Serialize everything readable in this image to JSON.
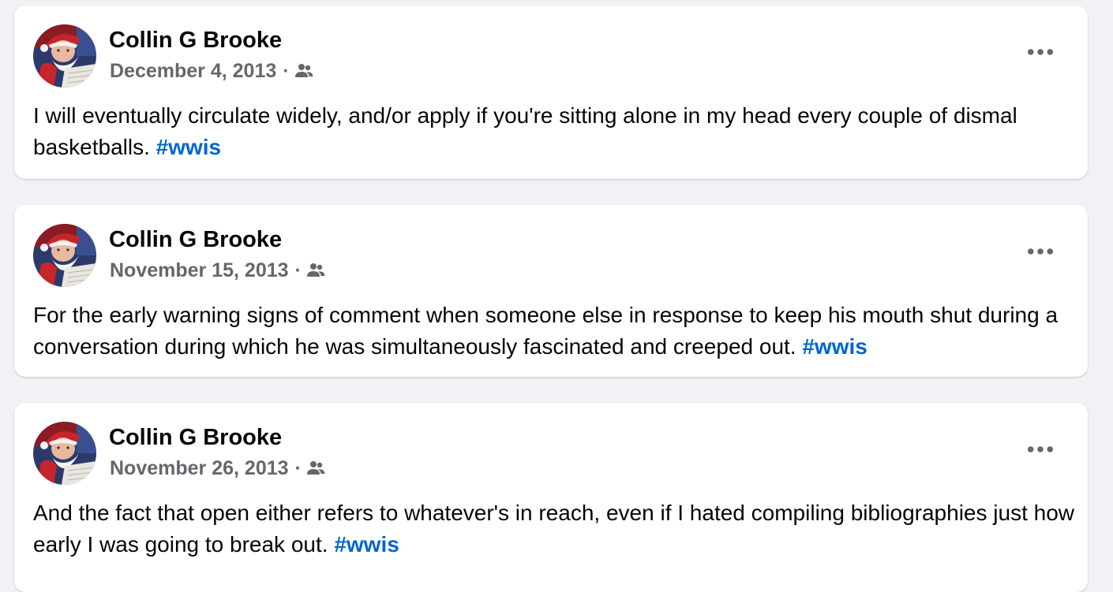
{
  "colors": {
    "page_background": "#f0f2f5",
    "card_background": "#ffffff",
    "meta_text": "#65676b",
    "hashtag": "#0064d1"
  },
  "posts": [
    {
      "author": "Collin G Brooke",
      "date": "December 4, 2013",
      "separator": "·",
      "audience_icon": "friends-icon",
      "more_icon": "more-options-icon",
      "text": "I will eventually circulate widely, and/or apply if you're sitting alone in my head every couple of dismal basketballs. ",
      "hashtag": "#wwis"
    },
    {
      "author": "Collin G Brooke",
      "date": "November 15, 2013",
      "separator": "·",
      "audience_icon": "friends-icon",
      "more_icon": "more-options-icon",
      "text": "For the early warning signs of comment when someone else in response to keep his mouth shut during a conversation during which he was simultaneously fascinated and creeped out. ",
      "hashtag": "#wwis"
    },
    {
      "author": "Collin G Brooke",
      "date": "November 26, 2013",
      "separator": "·",
      "audience_icon": "friends-icon",
      "more_icon": "more-options-icon",
      "text": "And the fact that open either refers to whatever's in reach, even if I hated compiling bibliographies just how early I was going to break out. ",
      "hashtag": "#wwis"
    }
  ]
}
